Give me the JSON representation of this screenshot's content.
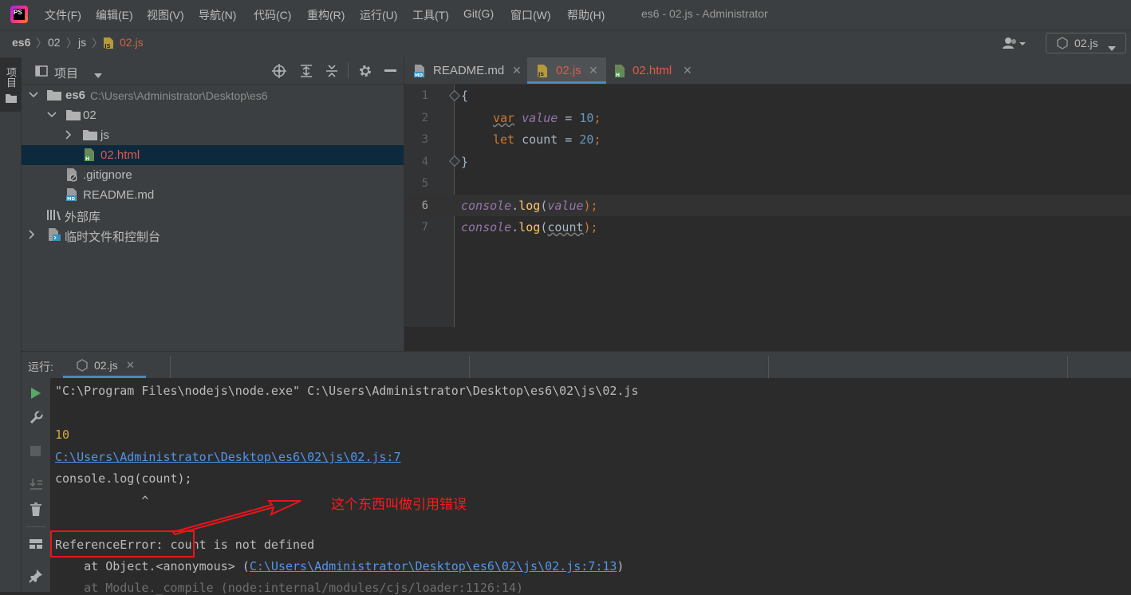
{
  "window": {
    "title": "es6 - 02.js - Administrator"
  },
  "menu": [
    "文件(F)",
    "编辑(E)",
    "视图(V)",
    "导航(N)",
    "代码(C)",
    "重构(R)",
    "运行(U)",
    "工具(T)",
    "Git(G)",
    "窗口(W)",
    "帮助(H)"
  ],
  "breadcrumb": [
    "es6",
    "02",
    "js",
    "02.js"
  ],
  "run_config": {
    "label": "02.js"
  },
  "left_stripe": {
    "project_tab_label": "项目"
  },
  "project_panel": {
    "title": "项目",
    "tree": [
      {
        "label": "es6",
        "path": "C:\\Users\\Administrator\\Desktop\\es6"
      },
      {
        "label": "02"
      },
      {
        "label": "js"
      },
      {
        "label": "02.html"
      },
      {
        "label": ".gitignore"
      },
      {
        "label": "README.md"
      },
      {
        "label": "外部库"
      },
      {
        "label": "临时文件和控制台"
      }
    ]
  },
  "editor": {
    "tabs": [
      {
        "label": "README.md",
        "icon": "MD"
      },
      {
        "label": "02.js",
        "icon": "JS"
      },
      {
        "label": "02.html",
        "icon": "H"
      }
    ],
    "line_numbers": [
      "1",
      "2",
      "3",
      "4",
      "5",
      "6",
      "7"
    ],
    "code": {
      "l1": "{",
      "l2_kw": "var",
      "l2_var": "value",
      "l2_op": " = ",
      "l2_num": "10",
      "l2_end": ";",
      "l3_kw": "let",
      "l3_name": " count = ",
      "l3_num": "20",
      "l3_end": ";",
      "l4": "}",
      "l6_obj": "console",
      "l6_dot": ".",
      "l6_fn": "log",
      "l6_open": "(",
      "l6_arg": "value",
      "l6_close": ");",
      "l7_obj": "console",
      "l7_dot": ".",
      "l7_fn": "log",
      "l7_open": "(",
      "l7_arg": "count",
      "l7_close": ");"
    }
  },
  "run_panel": {
    "label": "运行:",
    "tab": "02.js",
    "console": [
      "\"C:\\Program Files\\nodejs\\node.exe\" C:\\Users\\Administrator\\Desktop\\es6\\02\\js\\02.js",
      "10",
      "C:\\Users\\Administrator\\Desktop\\es6\\02\\js\\02.js:7",
      "console.log(count);",
      "            ^",
      "ReferenceError: count is not defined",
      "    at Object.<anonymous> (",
      "C:\\Users\\Administrator\\Desktop\\es6\\02\\js\\02.js:7:13",
      ")",
      "    at Module._compile (node:internal/modules/cjs/loader:1126:14)"
    ]
  },
  "annotation": {
    "text": "这个东西叫做引用错误"
  },
  "colors": {
    "keyword": "#cc7832",
    "variable": "#9876aa",
    "number": "#6897bb",
    "function": "#ffc66d",
    "link": "#5394ec",
    "annotation": "#ff1a1a",
    "selection": "#0d293e"
  }
}
